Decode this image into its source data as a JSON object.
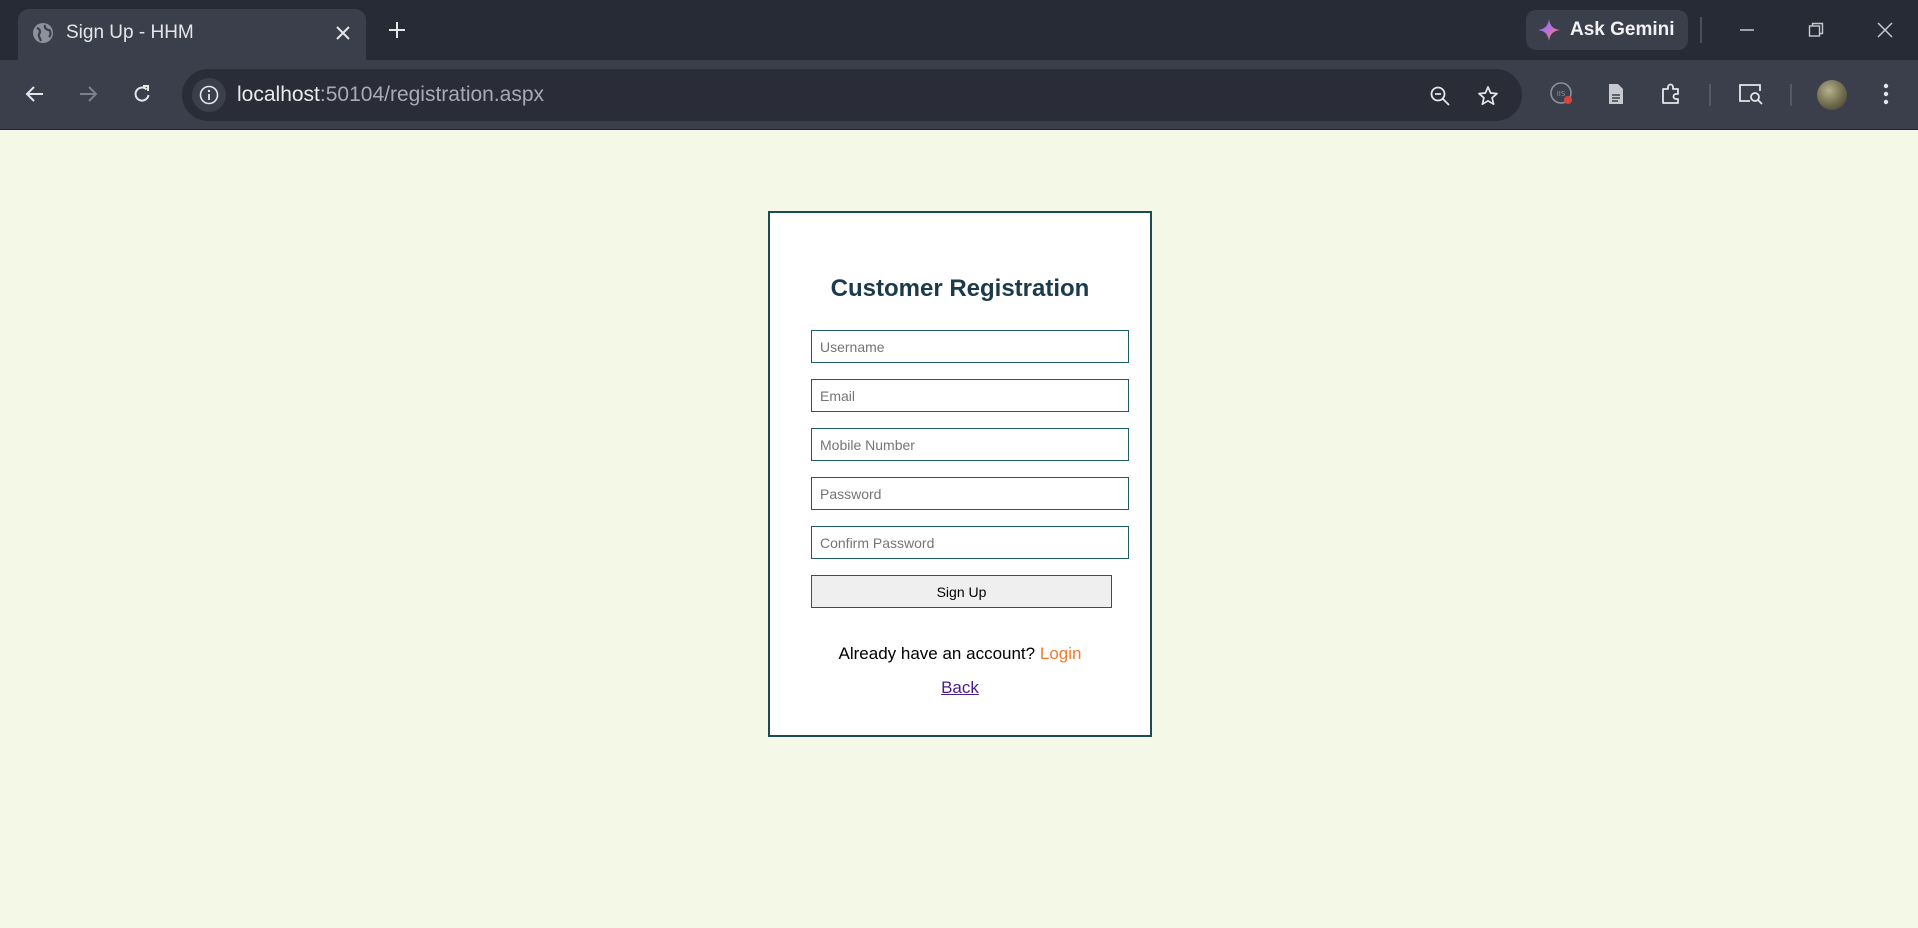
{
  "browser": {
    "tab_title": "Sign Up - HHM",
    "gemini_label": "Ask Gemini",
    "url_host": "localhost",
    "url_path": ":50104/registration.aspx"
  },
  "form": {
    "title": "Customer Registration",
    "fields": {
      "username": {
        "placeholder": "Username",
        "value": ""
      },
      "email": {
        "placeholder": "Email",
        "value": ""
      },
      "mobile": {
        "placeholder": "Mobile Number",
        "value": ""
      },
      "password": {
        "placeholder": "Password",
        "value": ""
      },
      "confirm_password": {
        "placeholder": "Confirm Password",
        "value": ""
      }
    },
    "submit_label": "Sign Up",
    "login_prompt": "Already have an account?",
    "login_label": "Login",
    "back_label": "Back"
  },
  "colors": {
    "page_background": "#f4f9e7",
    "card_border": "#1c4b54",
    "title": "#1b3a4b",
    "login_link": "#f07b2d",
    "back_link": "#4a1c87",
    "chrome_dark": "#272b36",
    "chrome_toolbar": "#3b3e4b"
  }
}
